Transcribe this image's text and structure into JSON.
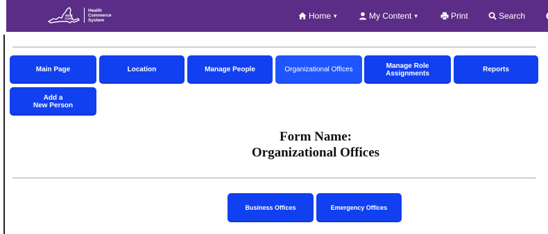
{
  "colors": {
    "header_bg": "#5b2d86",
    "button_bg": "#1140f0",
    "button_active_bg": "#1e55ff",
    "button_text": "#ffffff"
  },
  "header": {
    "logo": {
      "icon": "new-york-state-map-icon",
      "line1": "Health",
      "line2": "Commerce",
      "line3": "System"
    },
    "nav": {
      "home": {
        "label": "Home",
        "icon": "home-icon"
      },
      "my_content": {
        "label": "My Content",
        "icon": "user-icon"
      },
      "print": {
        "label": "Print",
        "icon": "printer-icon"
      },
      "search": {
        "label": "Search",
        "icon": "search-icon"
      }
    }
  },
  "menu": {
    "main_page": "Main Page",
    "location": "Location",
    "manage_people": "Manage People",
    "organizational_offices": "Organizational Offices",
    "manage_role_assignments_line1": "Manage Role",
    "manage_role_assignments_line2": "Assignments",
    "reports": "Reports",
    "add_person_line1": "Add a",
    "add_person_line2": "New Person"
  },
  "form": {
    "title_line1": "Form Name:",
    "title_line2": "Organizational Offices"
  },
  "sub_menu": {
    "business_offices": "Business Offices",
    "emergency_offices": "Emergency Offices"
  }
}
